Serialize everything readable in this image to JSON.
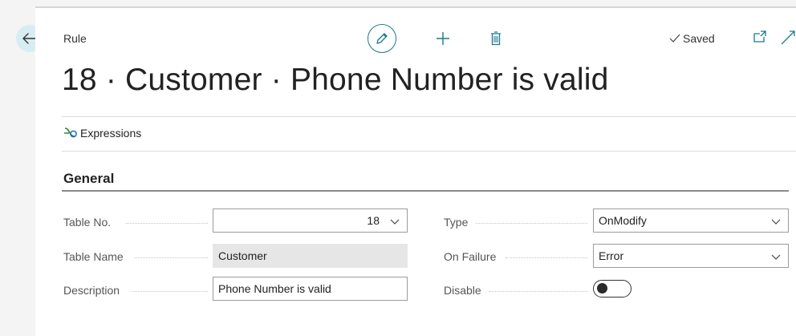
{
  "header": {
    "caption": "Rule",
    "title": "18 · Customer · Phone Number is valid",
    "saved_label": "Saved"
  },
  "actions": {
    "expressions_label": "Expressions"
  },
  "section": {
    "title": "General"
  },
  "fields": {
    "table_no": {
      "label": "Table No.",
      "value": "18"
    },
    "table_name": {
      "label": "Table Name",
      "value": "Customer"
    },
    "description": {
      "label": "Description",
      "value": "Phone Number is valid"
    },
    "type": {
      "label": "Type",
      "value": "OnModify"
    },
    "on_failure": {
      "label": "On Failure",
      "value": "Error"
    },
    "disable": {
      "label": "Disable",
      "value": false
    }
  },
  "colors": {
    "accent": "#1a7a8c",
    "back_button_bg": "#d8edf2",
    "readonly_bg": "#e6e6e6"
  }
}
